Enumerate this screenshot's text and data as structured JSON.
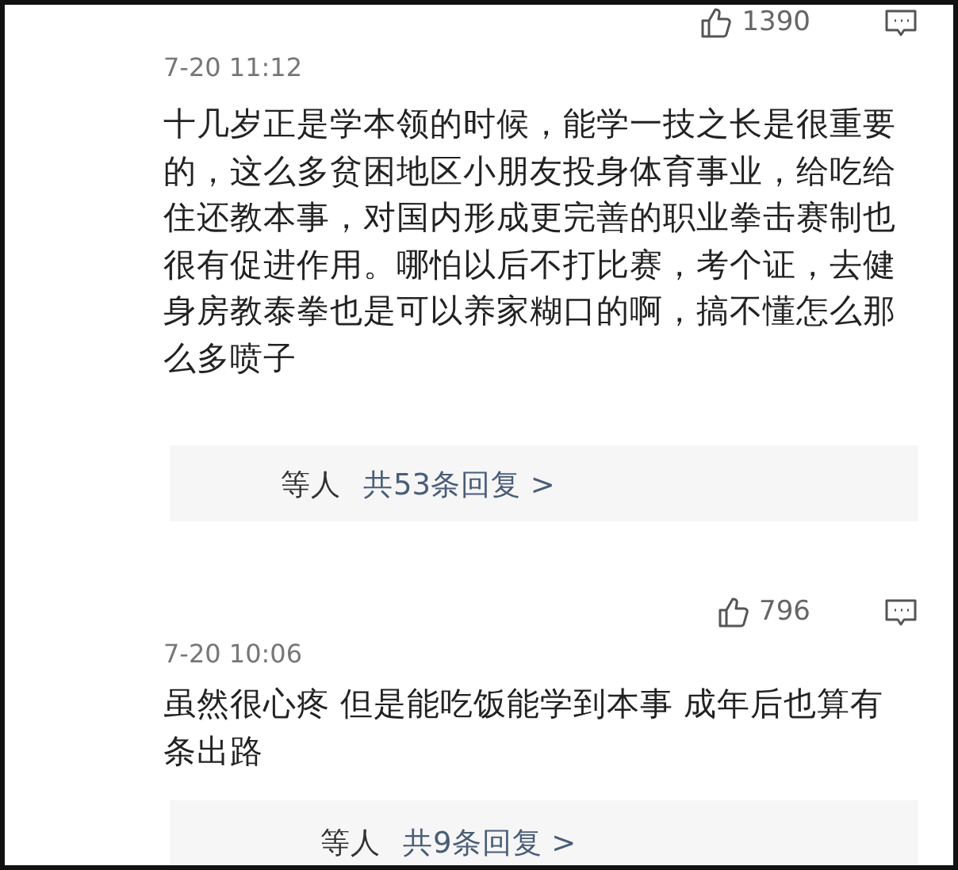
{
  "comments": [
    {
      "likes": "1390",
      "time": "7-20 11:12",
      "text": "十几岁正是学本领的时候，能学一技之长是很重要的，这么多贫困地区小朋友投身体育事业，给吃给住还教本事，对国内形成更完善的职业拳击赛制也很有促进作用。哪怕以后不打比赛，考个证，去健身房教泰拳也是可以养家糊口的啊，搞不懂怎么那么多喷子",
      "replies": {
        "suffix": "等人",
        "link": "共53条回复 >"
      }
    },
    {
      "likes": "796",
      "time": "7-20 10:06",
      "text": "虽然很心疼 但是能吃饭能学到本事 成年后也算有条出路",
      "replies": {
        "suffix": "等人",
        "link": "共9条回复 >"
      }
    }
  ]
}
